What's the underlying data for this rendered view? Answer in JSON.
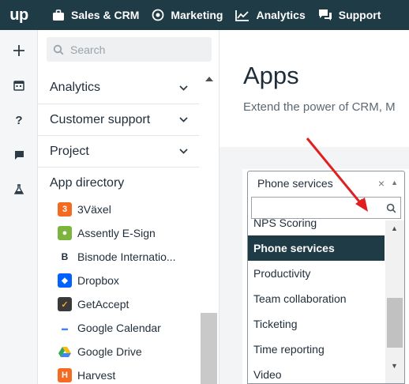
{
  "topbar": {
    "logo": "up",
    "nav": [
      {
        "label": "Sales & CRM",
        "icon": "briefcase-icon"
      },
      {
        "label": "Marketing",
        "icon": "target-icon"
      },
      {
        "label": "Analytics",
        "icon": "line-chart-icon"
      },
      {
        "label": "Support",
        "icon": "chat-bubbles-icon"
      }
    ]
  },
  "rail": {
    "icons": [
      "plus-icon",
      "calendar-icon",
      "help-icon",
      "comment-icon",
      "lab-icon"
    ]
  },
  "sidebar": {
    "search_placeholder": "Search",
    "sections": [
      {
        "label": "Analytics",
        "chevron": "chevron-down-icon"
      },
      {
        "label": "Customer support",
        "chevron": "chevron-down-icon"
      },
      {
        "label": "Project",
        "chevron": "chevron-down-icon"
      },
      {
        "label": "App directory"
      }
    ],
    "apps": [
      {
        "label": "3Växel",
        "icon_color": "#f26b21",
        "icon_char": "3"
      },
      {
        "label": "Assently E-Sign",
        "icon_color": "#7bb53d",
        "icon_char": "●"
      },
      {
        "label": "Bisnode Internatio...",
        "icon_color": "#ffffff",
        "icon_char": "B"
      },
      {
        "label": "Dropbox",
        "icon_color": "#0061ff",
        "icon_char": "◆"
      },
      {
        "label": "GetAccept",
        "icon_color": "#3a3a3a",
        "icon_char": "✓"
      },
      {
        "label": "Google Calendar",
        "icon_color": "#ffffff",
        "icon_char": "▬"
      },
      {
        "label": "Google Drive",
        "icon_color": "#ffffff",
        "icon_char": "▲"
      },
      {
        "label": "Harvest",
        "icon_color": "#f36c21",
        "icon_char": "H"
      }
    ]
  },
  "main": {
    "title": "Apps",
    "subtitle": "Extend the power of CRM, M"
  },
  "category_select": {
    "value": "Phone services",
    "clear": "×",
    "options": [
      "NPS Scoring",
      "Phone services",
      "Productivity",
      "Team collaboration",
      "Ticketing",
      "Time reporting",
      "Video"
    ],
    "selected": "Phone services"
  },
  "colors": {
    "nav_bg": "#1f3b45",
    "selected_bg": "#1f3b45",
    "annotation": "#e02020"
  }
}
